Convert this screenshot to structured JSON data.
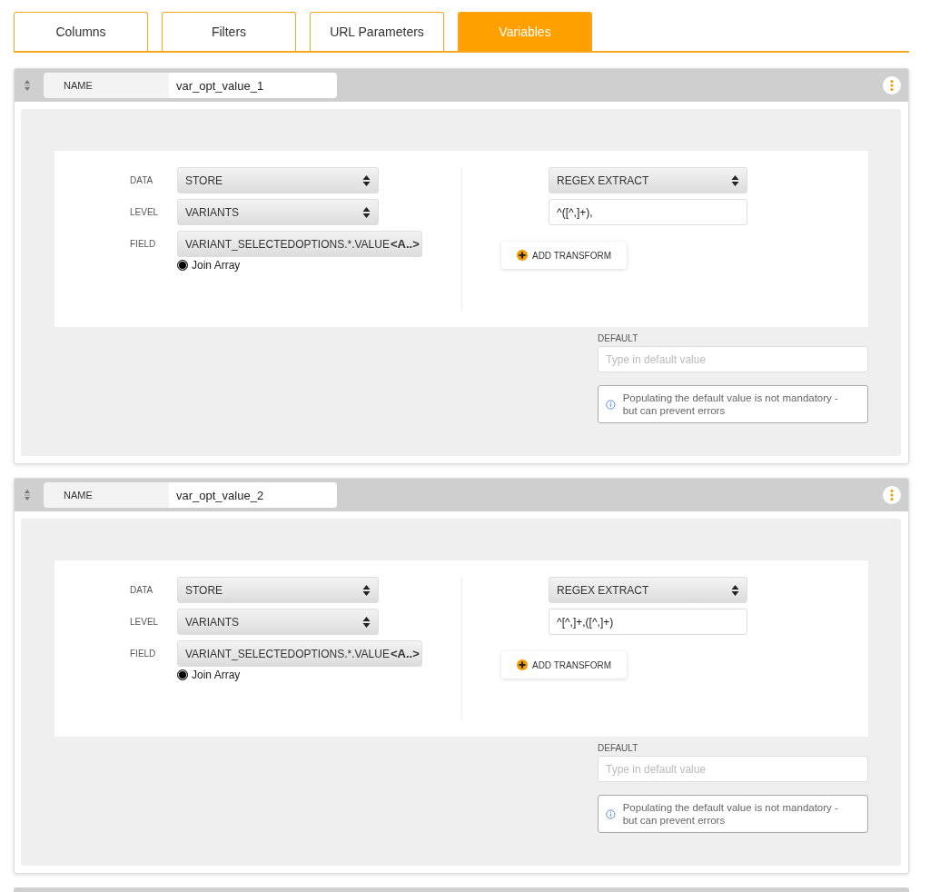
{
  "tabs": [
    {
      "label": "Columns",
      "selected": false
    },
    {
      "label": "Filters",
      "selected": false
    },
    {
      "label": "URL Parameters",
      "selected": false
    },
    {
      "label": "Variables",
      "selected": true
    }
  ],
  "variables": [
    {
      "name_label": "NAME",
      "name": "var_opt_value_1",
      "data_label": "DATA",
      "data": "STORE",
      "level_label": "LEVEL",
      "level_value": "VARIANTS",
      "field_label": "FIELD",
      "field": "VARIANT_SELECTEDOPTIONS.*.VALUE",
      "field_suffix": "<A..>",
      "join_array": {
        "label": "Join Array",
        "checked": true
      },
      "transform": "REGEX EXTRACT",
      "transform_value": "^([^,]+),",
      "add_transform": "ADD TRANSFORM",
      "default_label": "DEFAULT",
      "default_placeholder": "Type in default value",
      "info": "Populating the default value is not mandatory - but can prevent errors"
    },
    {
      "name_label": "NAME",
      "name": "var_opt_value_2",
      "data_label": "DATA",
      "data": "STORE",
      "level_label": "LEVEL",
      "level_value": "VARIANTS",
      "field_label": "FIELD",
      "field": "VARIANT_SELECTEDOPTIONS.*.VALUE",
      "field_suffix": "<A..>",
      "join_array": {
        "label": "Join Array",
        "checked": true
      },
      "transform": "REGEX EXTRACT",
      "transform_value": "^[^,]+,([^,]+)",
      "add_transform": "ADD TRANSFORM",
      "default_label": "DEFAULT",
      "default_placeholder": "Type in default value",
      "info": "Populating the default value is not mandatory - but can prevent errors"
    }
  ]
}
